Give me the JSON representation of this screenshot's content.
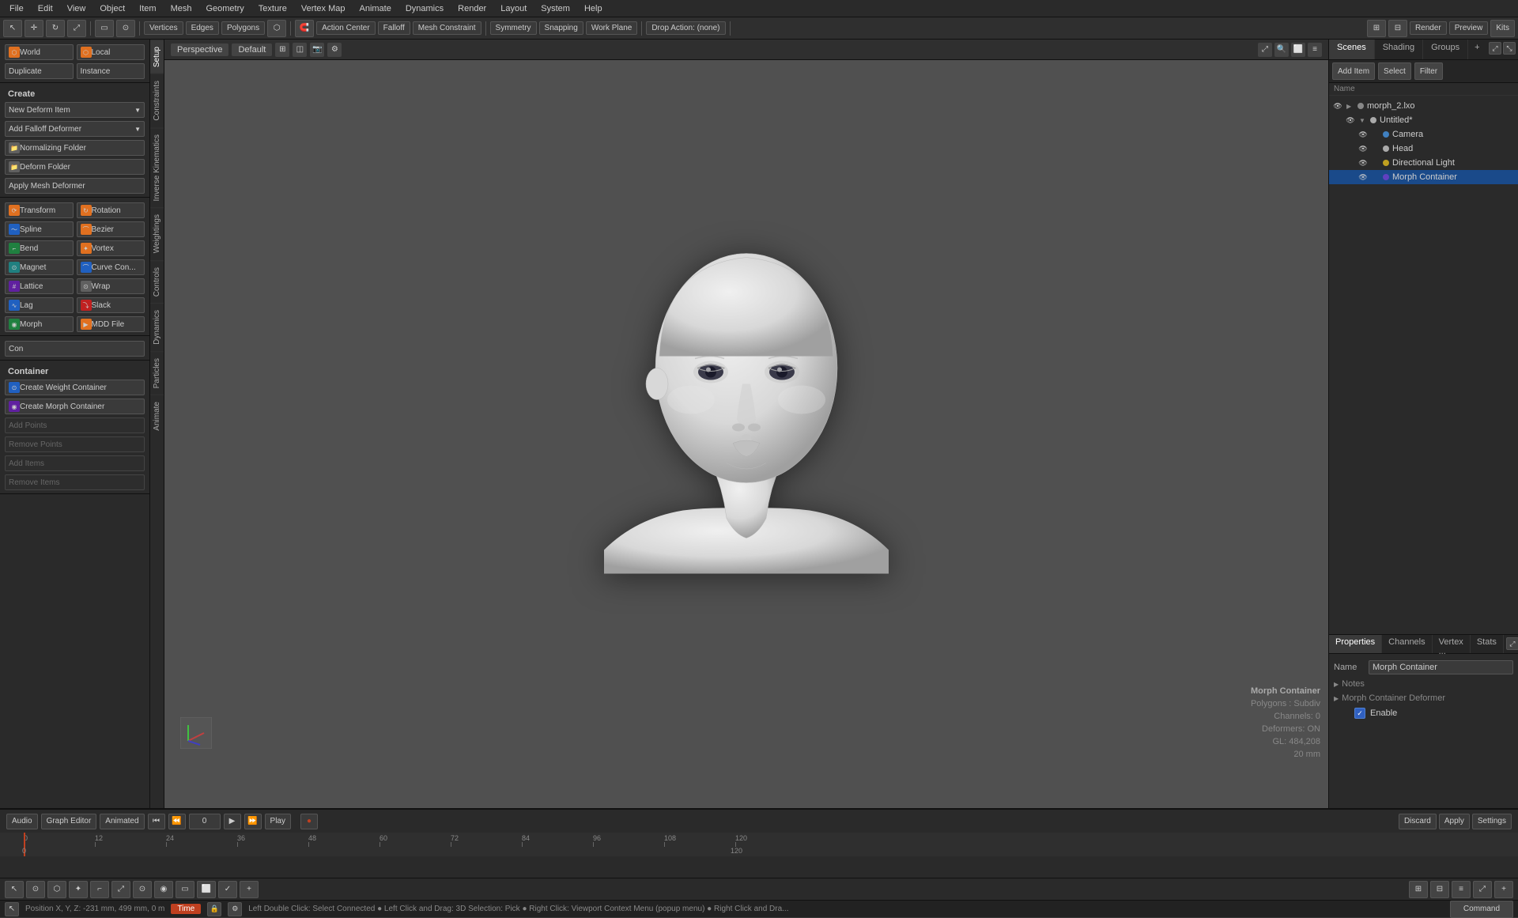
{
  "menubar": {
    "items": [
      "File",
      "Edit",
      "View",
      "Object",
      "Item",
      "Mesh",
      "Geometry",
      "Texture",
      "Vertex Map",
      "Animate",
      "Dynamics",
      "Render",
      "Layout",
      "System",
      "Help"
    ]
  },
  "toolbar": {
    "vertices_label": "Vertices",
    "edges_label": "Edges",
    "polygons_label": "Polygons",
    "action_center_label": "Action Center",
    "falloff_label": "Falloff",
    "mesh_constraint_label": "Mesh Constraint",
    "symmetry_label": "Symmetry",
    "snapping_label": "Snapping",
    "work_plane_label": "Work Plane",
    "drop_action_label": "Drop Action: (none)",
    "render_label": "Render",
    "preview_label": "Preview",
    "kits_label": "Kits"
  },
  "viewport_header": {
    "perspective": "Perspective",
    "default": "Default"
  },
  "left_panel": {
    "transform_label": "Transform",
    "rotation_label": "Rotation",
    "world_label": "World",
    "local_label": "Local",
    "duplicate_label": "Duplicate",
    "instance_label": "Instance",
    "create_label": "Create",
    "new_deform_item": "New Deform Item",
    "add_falloff_deformer": "Add Falloff Deformer",
    "normalizing_folder": "Normalizing Folder",
    "deform_folder": "Deform Folder",
    "apply_mesh_deformer": "Apply Mesh Deformer",
    "items": [
      {
        "icon": "orange",
        "label": "Transform"
      },
      {
        "icon": "orange",
        "label": "Rotation"
      },
      {
        "icon": "blue",
        "label": "Spline"
      },
      {
        "icon": "orange",
        "label": "Bezier"
      },
      {
        "icon": "green",
        "label": "Bend"
      },
      {
        "icon": "orange",
        "label": "Vortex"
      },
      {
        "icon": "teal",
        "label": "Magnet"
      },
      {
        "icon": "blue",
        "label": "Curve Con..."
      },
      {
        "icon": "purple",
        "label": "Lattice"
      },
      {
        "icon": "gray",
        "label": "Wrap"
      },
      {
        "icon": "blue",
        "label": "Lag"
      },
      {
        "icon": "red",
        "label": "Slack"
      },
      {
        "icon": "green",
        "label": "Morph"
      },
      {
        "icon": "orange",
        "label": "MDD File"
      }
    ],
    "container_label": "Container",
    "create_weight_container": "Create Weight Container",
    "create_morph_container": "Create Morph Container",
    "add_points": "Add Points",
    "remove_points": "Remove Points",
    "add_items": "Add Items",
    "remove_items": "Remove Items"
  },
  "side_tabs": [
    "Setup",
    "Constraints",
    "Inverse Kinematics",
    "Weightings",
    "Controls",
    "Dynamics",
    "Particles",
    "Animate"
  ],
  "viewport_info": {
    "title": "Morph Container",
    "polygons": "Polygons : Subdiv",
    "channels": "Channels: 0",
    "deformers": "Deformers: ON",
    "gl": "GL: 484,208",
    "size": "20 mm"
  },
  "scene_panel": {
    "tabs": [
      "Scenes",
      "Shading",
      "Groups"
    ],
    "add_item_label": "Add Item",
    "select_label": "Select",
    "filter_label": "Filter",
    "tree_items": [
      {
        "level": 0,
        "icon": "file",
        "color": "#888",
        "label": "morph_2.lxo",
        "has_arrow": true
      },
      {
        "level": 1,
        "icon": "scene",
        "color": "#aaa",
        "label": "Untitled*",
        "has_arrow": true,
        "selected": false
      },
      {
        "level": 2,
        "icon": "camera",
        "color": "#4080c0",
        "label": "Camera",
        "has_arrow": false
      },
      {
        "level": 2,
        "icon": "head",
        "color": "#aaa",
        "label": "Head",
        "has_arrow": false
      },
      {
        "level": 2,
        "icon": "light",
        "color": "#c0a020",
        "label": "Directional Light",
        "has_arrow": false
      },
      {
        "level": 2,
        "icon": "morph",
        "color": "#6040c0",
        "label": "Morph Container",
        "has_arrow": false,
        "selected": true
      }
    ]
  },
  "properties_panel": {
    "tabs": [
      "Properties",
      "Channels",
      "Vertex ...",
      "Stats"
    ],
    "name_label": "Name",
    "name_value": "Morph Container",
    "notes_label": "Notes",
    "section_label": "Morph Container Deformer",
    "enable_label": "Enable"
  },
  "timeline": {
    "ticks": [
      "0",
      "12",
      "24",
      "36",
      "48",
      "60",
      "72",
      "84",
      "96",
      "108",
      "120"
    ],
    "current_frame": "0",
    "end_frame": "120",
    "audio_label": "Audio",
    "graph_editor_label": "Graph Editor",
    "animated_label": "Animated",
    "play_label": "Play",
    "discard_label": "Discard",
    "apply_label": "Apply",
    "settings_label": "Settings"
  },
  "status_bar": {
    "position": "Position X, Y, Z:  -231 mm, 499 mm, 0 m",
    "time_label": "Time",
    "hint": "Left Double Click: Select Connected ● Left Click and Drag: 3D Selection: Pick ● Right Click: Viewport Context Menu (popup menu) ● Right Click and Dra..."
  }
}
